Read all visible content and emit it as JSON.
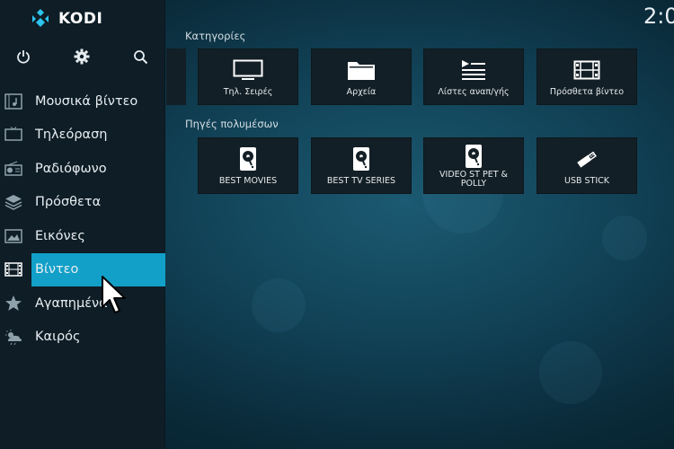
{
  "app": {
    "brand": "KODI",
    "clock": "2:0"
  },
  "top_icons": [
    "power-icon",
    "gear-icon",
    "search-icon"
  ],
  "sidebar": {
    "items": [
      {
        "label": "Μουσικά βίντεο",
        "icon": "music-video-icon",
        "active": false
      },
      {
        "label": "Τηλεόραση",
        "icon": "tv-icon",
        "active": false
      },
      {
        "label": "Ραδιόφωνο",
        "icon": "radio-icon",
        "active": false
      },
      {
        "label": "Πρόσθετα",
        "icon": "addons-icon",
        "active": false
      },
      {
        "label": "Εικόνες",
        "icon": "pictures-icon",
        "active": false
      },
      {
        "label": "Βίντεο",
        "icon": "film-icon",
        "active": true
      },
      {
        "label": "Αγαπημένα",
        "icon": "star-icon",
        "active": false
      },
      {
        "label": "Καιρός",
        "icon": "weather-icon",
        "active": false
      }
    ]
  },
  "categories": {
    "title": "Κατηγορίες",
    "tiles": [
      {
        "label": "Τηλ. Σειρές",
        "icon": "tv-icon"
      },
      {
        "label": "Αρχεία",
        "icon": "folder-icon"
      },
      {
        "label": "Λίστες αναπ/γής",
        "icon": "playlist-icon"
      },
      {
        "label": "Πρόσθετα βίντεο",
        "icon": "film-icon"
      }
    ]
  },
  "sources": {
    "title": "Πηγές πολυμέσων",
    "tiles": [
      {
        "label": "BEST MOVIES",
        "icon": "harddisk-icon"
      },
      {
        "label": "BEST TV SERIES",
        "icon": "harddisk-icon"
      },
      {
        "label": "VIDEO ST PET & POLLY",
        "icon": "harddisk-icon"
      },
      {
        "label": "USB STICK",
        "icon": "usb-icon"
      }
    ]
  },
  "colors": {
    "accent": "#12a0c8",
    "sidebar_bg": "#0e1d26",
    "tile_bg": "#131f26"
  }
}
